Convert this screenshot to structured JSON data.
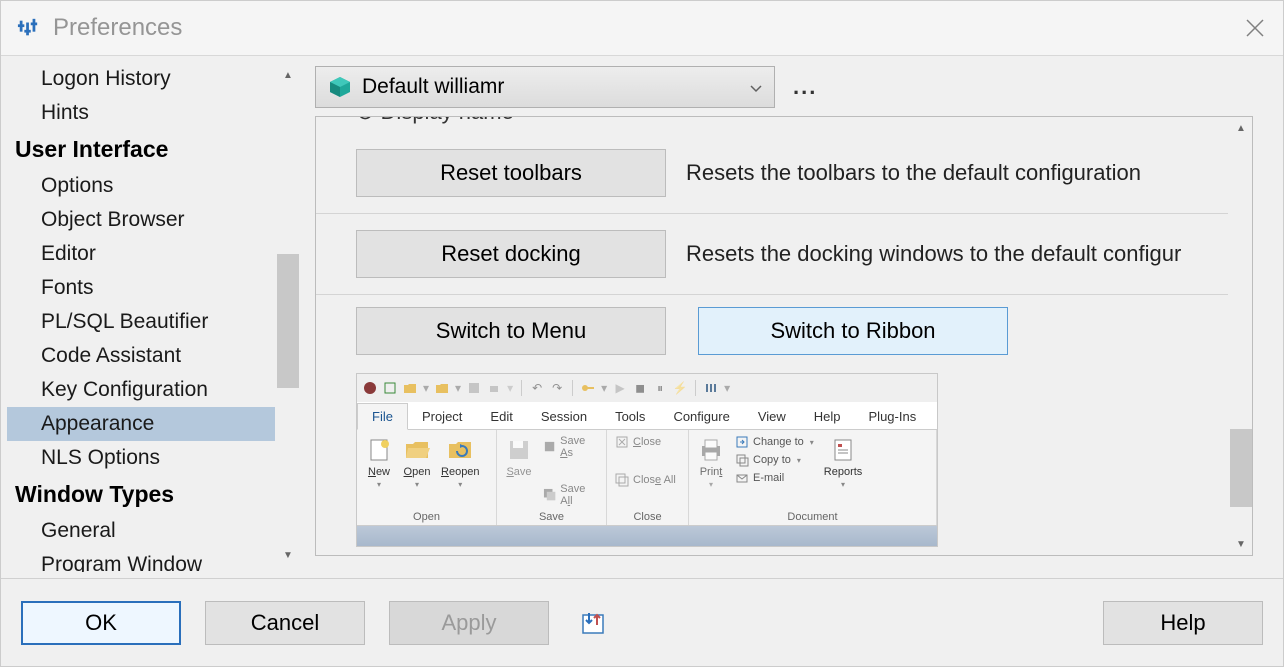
{
  "window": {
    "title": "Preferences"
  },
  "tree": {
    "items_before": [
      "Logon History",
      "Hints"
    ],
    "header1": "User Interface",
    "ui_items": [
      "Options",
      "Object Browser",
      "Editor",
      "Fonts",
      "PL/SQL Beautifier",
      "Code Assistant",
      "Key Configuration",
      "Appearance",
      "NLS Options"
    ],
    "selected": "Appearance",
    "header2": "Window Types",
    "wt_items": [
      "General",
      "Program Window"
    ]
  },
  "profile": {
    "label": "Default williamr",
    "ellipsis": "..."
  },
  "cut_header": "Display name",
  "rows": {
    "reset_toolbars": {
      "btn": "Reset toolbars",
      "desc": "Resets the toolbars to the default configuration"
    },
    "reset_docking": {
      "btn": "Reset docking",
      "desc": "Resets the docking windows to the default configur"
    },
    "switch_menu": "Switch to Menu",
    "switch_ribbon": "Switch to Ribbon"
  },
  "ribbon": {
    "tabs": [
      "File",
      "Project",
      "Edit",
      "Session",
      "Tools",
      "Configure",
      "View",
      "Help",
      "Plug-Ins"
    ],
    "active_tab": "File",
    "groups": {
      "open": {
        "label": "Open",
        "new": "New",
        "open": "Open",
        "reopen": "Reopen"
      },
      "save": {
        "label": "Save",
        "save": "Save",
        "saveas": "Save As",
        "saveall": "Save All"
      },
      "close": {
        "label": "Close",
        "close": "Close",
        "closeall": "Close All"
      },
      "document": {
        "label": "Document",
        "print": "Print",
        "changeto": "Change to",
        "copyto": "Copy to",
        "email": "E-mail",
        "reports": "Reports"
      }
    }
  },
  "buttons": {
    "ok": "OK",
    "cancel": "Cancel",
    "apply": "Apply",
    "help": "Help"
  }
}
